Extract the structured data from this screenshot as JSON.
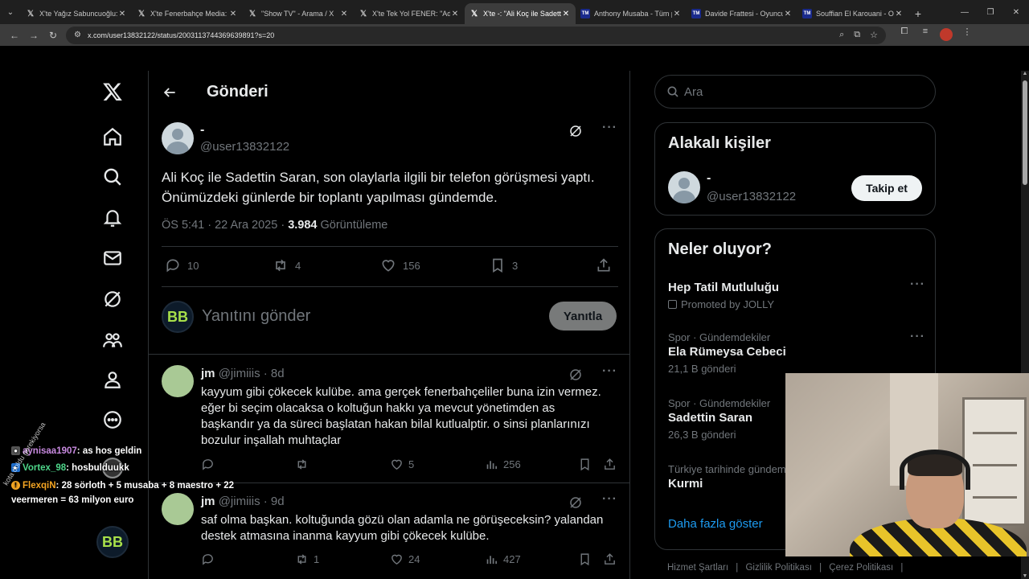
{
  "browser": {
    "tabs": [
      {
        "title": "X'te Yağız Sabuncuoğlu: \"",
        "fav": "X"
      },
      {
        "title": "X'te Fenerbahçe Media: \"",
        "fav": "X"
      },
      {
        "title": "\"Show TV\" - Arama / X",
        "fav": "X"
      },
      {
        "title": "X'te Tek Yol FENER: \"Adid",
        "fav": "X"
      },
      {
        "title": "X'te -: \"Ali Koç ile Sadettin",
        "fav": "X",
        "active": true
      },
      {
        "title": "Anthony Musaba - Tüm p",
        "fav": "tm"
      },
      {
        "title": "Davide Frattesi - Oyuncu",
        "fav": "tm"
      },
      {
        "title": "Souffian El Karouani - Oy",
        "fav": "tm"
      }
    ],
    "url": "x.com/user13832122/status/2003113744369639891?s=20"
  },
  "header": {
    "title": "Gönderi"
  },
  "post": {
    "name": "-",
    "handle": "@user13832122",
    "text_line1": "Ali Koç ile Sadettin Saran, son olaylarla ilgili bir telefon görüşmesi yaptı.",
    "text_line2": "Önümüzdeki günlerde bir toplantı yapılması gündemde.",
    "time": "ÖS 5:41 · 22 Ara 2025 · ",
    "views": "3.984",
    "views_label": " Görüntüleme",
    "replies": "10",
    "reposts": "4",
    "likes": "156",
    "bookmarks": "3"
  },
  "compose": {
    "placeholder": "Yanıtını gönder",
    "button": "Yanıtla",
    "avatar_text": "BB"
  },
  "replies": [
    {
      "name": "jm",
      "meta": "@jimiiis · 8d",
      "text": [
        "kayyum gibi çökecek kulübe. ama gerçek fenerbahçeliler buna izin vermez.",
        "eğer bi seçim olacaksa o koltuğun hakkı ya mevcut yönetimden as",
        "başkandır ya da süreci başlatan hakan bilal kutlualptir.  o sinsi planlarınızı",
        "bozulur inşallah muhtaçlar"
      ],
      "reposts": "",
      "likes": "5",
      "views": "256"
    },
    {
      "name": "jm",
      "meta": "@jimiiis · 9d",
      "text": [
        "saf olma başkan. koltuğunda gözü olan adamla ne görüşeceksin? yalandan",
        "destek atmasına inanma kayyum gibi çökecek kulübe."
      ],
      "reposts": "1",
      "likes": "24",
      "views": "427"
    }
  ],
  "sidebar": {
    "search_placeholder": "Ara",
    "related_title": "Alakalı kişiler",
    "related_name": "-",
    "related_handle": "@user13832122",
    "follow_label": "Takip et",
    "trends_title": "Neler oluyor?",
    "promo": {
      "name": "Hep Tatil Mutluluğu",
      "by": "Promoted by JOLLY"
    },
    "trends": [
      {
        "category": "Spor · Gündemdekiler",
        "name": "Ela Rümeysa Cebeci",
        "count": "21,1 B gönderi"
      },
      {
        "category": "Spor · Gündemdekiler",
        "name": "Sadettin Saran",
        "count": "26,3 B gönderi"
      },
      {
        "category": "Türkiye tarihinde gündem",
        "name": "Kurmi",
        "count": ""
      }
    ],
    "show_more": "Daha fazla göster",
    "footer": [
      "Hizmet Şartları",
      "|",
      "Gizlilik Politikası",
      "|",
      "Çerez Politikası",
      "|"
    ]
  },
  "stream_chat": [
    {
      "user": "aynisaa1907",
      "msg": ": as hos geldin"
    },
    {
      "user": "Vortex_98",
      "msg": ": hosbulduukk"
    },
    {
      "user": "FlexqiN",
      "msg": ": 28 sörloth + 5 musaba + 8 maestro + 22"
    },
    {
      "user": "",
      "msg": "veermeren = 63 milyon euro"
    }
  ],
  "watermark": "kota doldu gerekiyorsa",
  "colors": {
    "accent": "#1d9bf0",
    "bg": "#000000",
    "muted": "#71767b"
  }
}
